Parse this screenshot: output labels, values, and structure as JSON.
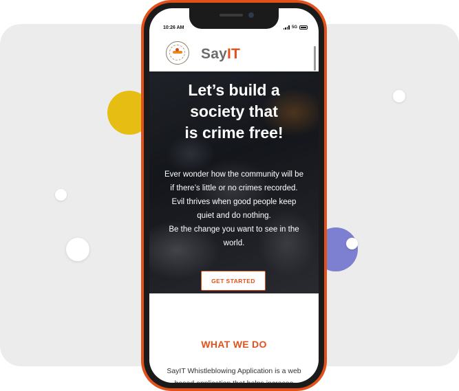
{
  "status_bar": {
    "time": "10:26 AM",
    "network": "5G",
    "icons": [
      "signal-icon",
      "battery-icon"
    ]
  },
  "header": {
    "brand_prefix": "Say",
    "brand_suffix": "IT",
    "logo_icon": "sayit-logo"
  },
  "hero": {
    "title_lines": [
      "Let’s build a",
      "society that",
      "is crime free!"
    ],
    "text_lines": [
      "Ever wonder how the community will be",
      "if there’s little or no crimes recorded.",
      "Evil thrives when good people keep",
      "quiet and do nothing.",
      "Be the change you want to see in the",
      "world."
    ],
    "cta_label": "GET STARTED"
  },
  "what_we_do": {
    "title": "WHAT WE DO",
    "text_lines": [
      "SayIT Whistleblowing Application is a web",
      "based application that helps increase"
    ]
  },
  "colors": {
    "accent": "#e2511c",
    "phone_frame": "#e2511c",
    "dot_yellow": "#e5bd13",
    "dot_purple": "#7d7fd1",
    "background_card": "#ececec"
  }
}
